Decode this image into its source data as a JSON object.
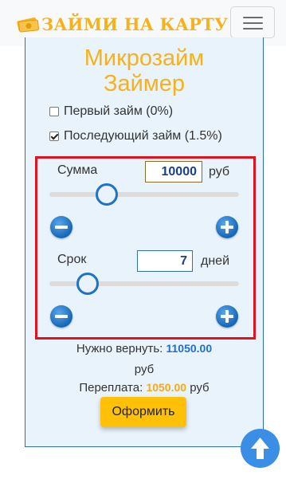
{
  "navbar": {
    "brand_text": "ЗАЙМИ НА КАРТУ",
    "logo_icon": "money-stack-icon",
    "menu_icon": "hamburger-menu-icon"
  },
  "card": {
    "title_line1": "Микрозайм",
    "title_line2": "Займер"
  },
  "options": [
    {
      "label": "Первый займ (0%)",
      "checked": false
    },
    {
      "label": "Последующий займ (1.5%)",
      "checked": true
    }
  ],
  "calculator": {
    "amount": {
      "label": "Сумма",
      "value": "10000",
      "unit": "руб",
      "slider_fraction": 0.3
    },
    "term": {
      "label": "Срок",
      "value": "7",
      "unit": "дней",
      "slider_fraction": 0.2
    },
    "minus_icon": "minus-circle-icon",
    "plus_icon": "plus-circle-icon"
  },
  "summary": {
    "return_label": "Нужно вернуть:",
    "return_value": "11050.00",
    "return_unit": "руб",
    "overpay_label": "Переплата:",
    "overpay_value": "1050.00",
    "overpay_unit": "руб"
  },
  "submit_label": "Оформить",
  "scroll_top_icon": "arrow-up-icon",
  "colors": {
    "brand": "#f7b21b",
    "accent_blue": "#1e72c8",
    "highlight_border": "#e0141e",
    "button_yellow": "#ffc107"
  }
}
